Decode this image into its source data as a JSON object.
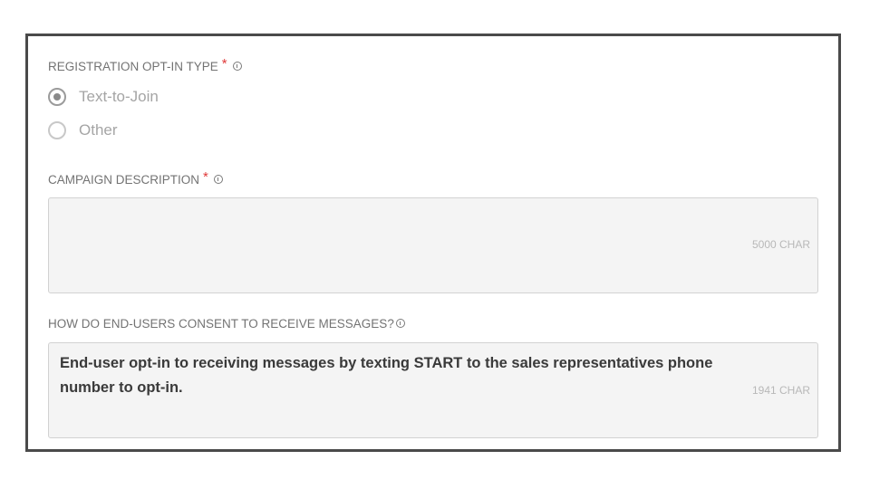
{
  "optin": {
    "label": "REGISTRATION OPT-IN TYPE",
    "required_mark": "*",
    "options": [
      {
        "label": "Text-to-Join",
        "selected": true
      },
      {
        "label": "Other",
        "selected": false
      }
    ]
  },
  "campaign": {
    "label": "CAMPAIGN DESCRIPTION",
    "required_mark": "*",
    "value": "",
    "char_count": "5000 CHAR"
  },
  "consent": {
    "label": "HOW DO END-USERS CONSENT TO RECEIVE MESSAGES?",
    "value": "End-user opt-in to receiving messages by texting START to the sales representatives phone number to opt-in.",
    "char_count": "1941 CHAR"
  },
  "colors": {
    "required": "#e03a3a",
    "field_bg": "#f4f4f4",
    "frame_border": "#4a4a4a"
  },
  "icons": [
    "info-icon",
    "radio-checked-icon",
    "radio-unchecked-icon"
  ]
}
